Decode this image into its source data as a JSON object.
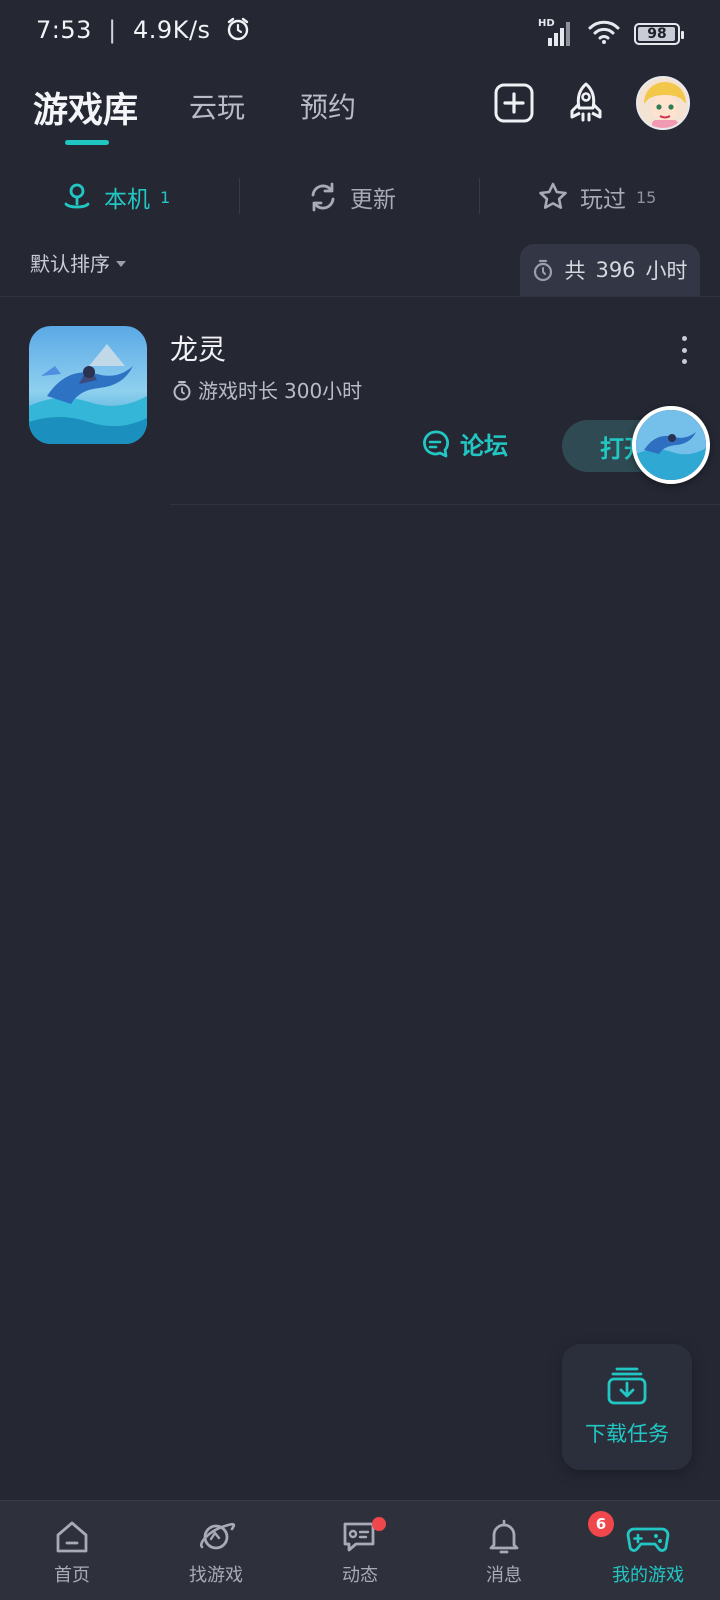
{
  "status_bar": {
    "time": "7:53",
    "speed": "4.9K/s",
    "network_badge": "HD",
    "battery": "98",
    "battery_level": 0.98
  },
  "header": {
    "active_tab": "游戏库",
    "tabs": [
      "游戏库",
      "云玩",
      "预约"
    ]
  },
  "filters": [
    {
      "label": "本机",
      "count": "1",
      "icon": "location-icon",
      "active": true
    },
    {
      "label": "更新",
      "count": "",
      "icon": "refresh-icon",
      "active": false
    },
    {
      "label": "玩过",
      "count": "15",
      "icon": "star-icon",
      "active": false
    }
  ],
  "sort": {
    "label": "默认排序"
  },
  "total_time": {
    "prefix": "共",
    "value": "396",
    "unit": "小时"
  },
  "games": [
    {
      "title": "龙灵",
      "playtime_label": "游戏时长",
      "playtime_value": "300小时",
      "forum_label": "论坛",
      "open_label": "打开"
    }
  ],
  "download_tasks": {
    "label": "下载任务"
  },
  "bottom_nav": [
    {
      "label": "首页",
      "icon": "home-icon"
    },
    {
      "label": "找游戏",
      "icon": "planet-icon"
    },
    {
      "label": "动态",
      "icon": "chat-icon"
    },
    {
      "label": "消息",
      "icon": "bell-icon"
    },
    {
      "label": "我的游戏",
      "icon": "gamepad-icon",
      "badge": "6"
    }
  ],
  "colors": {
    "background": "#252733",
    "accent": "#22c7c3",
    "badge": "#f0474c",
    "nav_background": "#2e303c"
  }
}
